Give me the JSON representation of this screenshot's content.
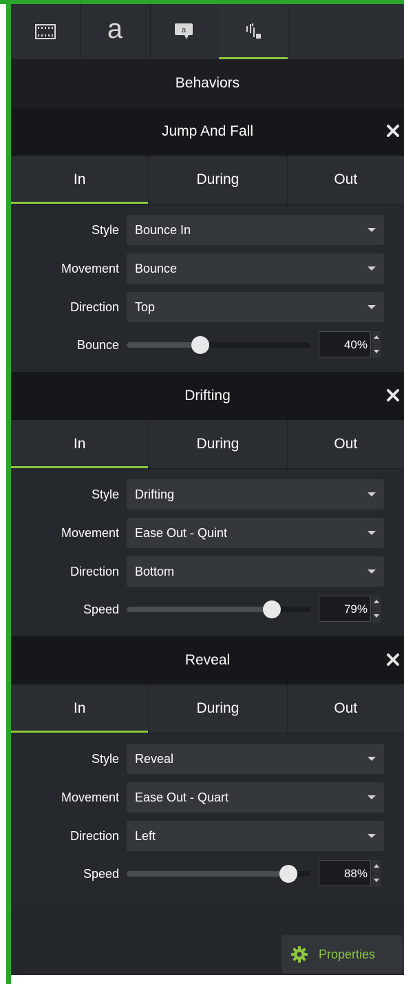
{
  "toolbar": {
    "tabs": [
      {
        "icon": "film-strip-icon",
        "label": ""
      },
      {
        "icon": "annotation-text-icon",
        "label": "a"
      },
      {
        "icon": "callout-icon",
        "label": "a"
      },
      {
        "icon": "behaviors-icon",
        "label": "",
        "active": true
      }
    ]
  },
  "panel": {
    "title": "Behaviors"
  },
  "behaviors": [
    {
      "name": "Jump And Fall",
      "phases": [
        "In",
        "During",
        "Out"
      ],
      "active_phase": "In",
      "properties": {
        "style_label": "Style",
        "style_value": "Bounce In",
        "movement_label": "Movement",
        "movement_value": "Bounce",
        "direction_label": "Direction",
        "direction_value": "Top",
        "slider_label": "Bounce",
        "slider_value": "40%",
        "slider_fraction": 0.4
      }
    },
    {
      "name": "Drifting",
      "phases": [
        "In",
        "During",
        "Out"
      ],
      "active_phase": "In",
      "properties": {
        "style_label": "Style",
        "style_value": "Drifting",
        "movement_label": "Movement",
        "movement_value": "Ease Out - Quint",
        "direction_label": "Direction",
        "direction_value": "Bottom",
        "slider_label": "Speed",
        "slider_value": "79%",
        "slider_fraction": 0.79
      }
    },
    {
      "name": "Reveal",
      "phases": [
        "In",
        "During",
        "Out"
      ],
      "active_phase": "In",
      "properties": {
        "style_label": "Style",
        "style_value": "Reveal",
        "movement_label": "Movement",
        "movement_value": "Ease Out - Quart",
        "direction_label": "Direction",
        "direction_value": "Left",
        "slider_label": "Speed",
        "slider_value": "88%",
        "slider_fraction": 0.88
      }
    }
  ],
  "footer": {
    "properties_label": "Properties"
  },
  "colors": {
    "accent": "#8dc63f",
    "window_border": "#2aa52b",
    "background": "#24272b"
  }
}
